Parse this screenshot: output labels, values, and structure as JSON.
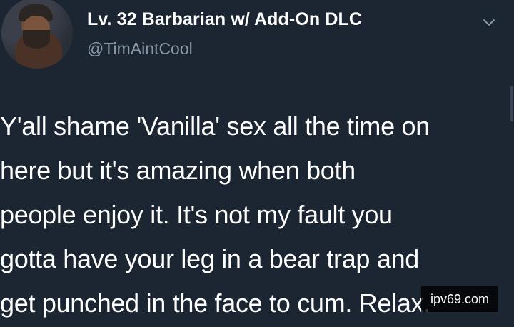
{
  "tweet": {
    "display_name": "Lv. 32 Barbarian w/ Add-On DLC",
    "handle": "@TimAintCool",
    "menu_icon": "chevron-down-icon",
    "text_lines": [
      "Y'all shame 'Vanilla' sex all the time on",
      "here but it's amazing when both",
      "people enjoy it. It's not my fault you",
      "gotta have your leg in a bear trap and",
      "get punched in the face to cum. Relax."
    ]
  },
  "watermark": {
    "text": "ipv69.com"
  },
  "colors": {
    "background": "#1c2532",
    "text": "#ffffff",
    "handle": "#8899a6"
  }
}
